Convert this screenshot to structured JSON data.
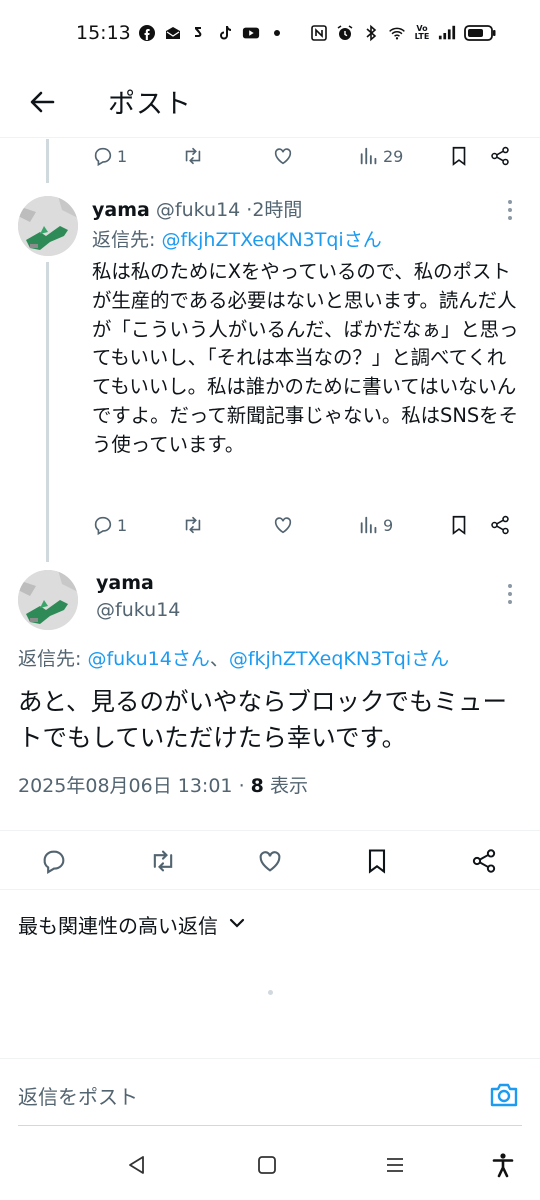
{
  "status_bar": {
    "time": "15:13",
    "left_icons": [
      "facebook-icon",
      "mail-icon",
      "app-icon",
      "tiktok-icon",
      "youtube-icon",
      "dot-icon"
    ],
    "right_icons": [
      "nfc-icon",
      "alarm-icon",
      "bluetooth-icon",
      "wifi-icon",
      "volte-icon",
      "signal-icon",
      "battery-icon"
    ],
    "volte_label": "Vo LTE"
  },
  "header": {
    "title": "ポスト"
  },
  "prev_tweet_actions": {
    "replies": "1",
    "views": "29"
  },
  "reply_tweet": {
    "name": "yama",
    "handle": "@fuku14",
    "separator": "·",
    "time": "2時間",
    "reply_to_prefix": "返信先: ",
    "reply_to": "@fkjhZTXeqKN3Tqiさん",
    "text": "私は私のためにXをやっているので、私のポストが生産的である必要はないと思います。読んだ人が「こういう人がいるんだ、ばかだなぁ」と思ってもいいし、「それは本当なの？」と調べてくれてもいいし。私は誰かのために書いてはいないんですよ。だって新聞記事じゃない。私はSNSをそう使っています。",
    "replies": "1",
    "views": "9"
  },
  "main_tweet": {
    "name": "yama",
    "handle": "@fuku14",
    "reply_to_prefix": "返信先: ",
    "reply_to_1": "@fuku14さん",
    "reply_to_sep": "、",
    "reply_to_2": "@fkjhZTXeqKN3Tqiさん",
    "text": "あと、見るのがいやならブロックでもミュートでもしていただけたら幸いです。",
    "timestamp": "2025年08月06日 13:01",
    "separator": "·",
    "view_count": "8",
    "view_label": "表示"
  },
  "sort": {
    "label": "最も関連性の高い返信"
  },
  "reply_bar": {
    "placeholder": "返信をポスト"
  },
  "colors": {
    "accent": "#1d9bf0",
    "muted": "#536471",
    "divider": "#eff3f4"
  }
}
